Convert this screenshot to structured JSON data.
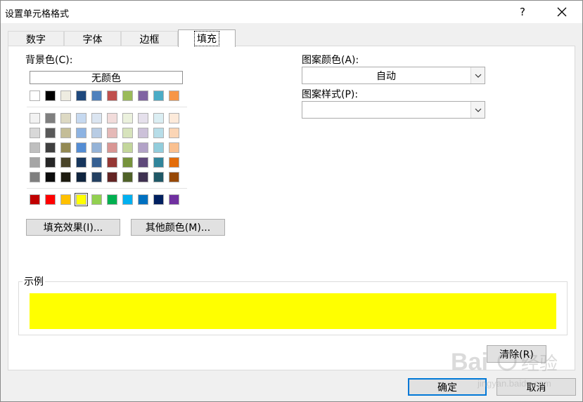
{
  "window": {
    "title": "设置单元格格式",
    "help_label": "?",
    "close_icon": "close-icon"
  },
  "tabs": [
    {
      "label": "数字",
      "active": false
    },
    {
      "label": "字体",
      "active": false
    },
    {
      "label": "边框",
      "active": false
    },
    {
      "label": "填充",
      "active": true
    }
  ],
  "fill": {
    "background_color_label": "背景色(C):",
    "no_color_label": "无颜色",
    "theme_row": [
      "#ffffff",
      "#000000",
      "#eeece1",
      "#1f497d",
      "#4f81bd",
      "#c0504d",
      "#9bbb59",
      "#8064a2",
      "#4bacc6",
      "#f79646"
    ],
    "tint_rows": [
      [
        "#f2f2f2",
        "#7f7f7f",
        "#ddd9c3",
        "#c6d9f0",
        "#dbe5f1",
        "#f2dcdb",
        "#ebf1dd",
        "#e5e0ec",
        "#dbeef3",
        "#fdeada"
      ],
      [
        "#d8d8d8",
        "#595959",
        "#c4bd97",
        "#8db3e2",
        "#b8cce4",
        "#e5b9b7",
        "#d7e3bc",
        "#ccc1d9",
        "#b7dde8",
        "#fbd5b5"
      ],
      [
        "#bfbfbf",
        "#3f3f3f",
        "#938953",
        "#548dd4",
        "#95b3d7",
        "#d99694",
        "#c3d69b",
        "#b2a2c7",
        "#92cddc",
        "#fac08f"
      ],
      [
        "#a5a5a5",
        "#262626",
        "#494429",
        "#17365d",
        "#366092",
        "#953734",
        "#76923c",
        "#5f497a",
        "#31859b",
        "#e36c09"
      ],
      [
        "#7f7f7f",
        "#0c0c0c",
        "#1d1b10",
        "#0f243e",
        "#244061",
        "#632423",
        "#4f6128",
        "#3f3151",
        "#205867",
        "#974806"
      ]
    ],
    "standard_row": [
      "#c00000",
      "#ff0000",
      "#ffc000",
      "#ffff00",
      "#92d050",
      "#00b050",
      "#00b0f0",
      "#0070c0",
      "#002060",
      "#7030a0"
    ],
    "selected_color": "#ffff00",
    "fill_effects_label": "填充效果(I)...",
    "more_colors_label": "其他颜色(M)...",
    "pattern_color_label": "图案颜色(A):",
    "pattern_color_value": "自动",
    "pattern_style_label": "图案样式(P):",
    "pattern_style_value": "",
    "sample_label": "示例",
    "sample_color": "#ffff00",
    "clear_label": "清除(R)"
  },
  "footer": {
    "ok_label": "确定",
    "cancel_label": "取消"
  },
  "watermark": {
    "brand": "Bai",
    "brand2": "经验",
    "url": "jingyan.baidu.com"
  }
}
